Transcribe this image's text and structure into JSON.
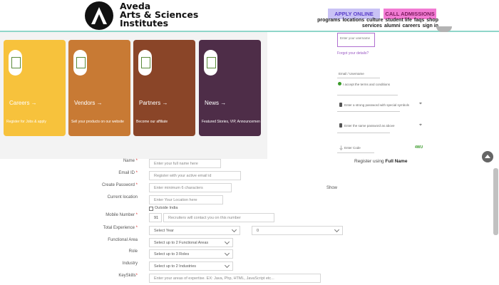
{
  "header": {
    "brand_line1": "Aveda",
    "brand_line2": "Arts & Sciences",
    "brand_line3": "Institutes",
    "apply_label": "APPLY ONLINE",
    "call_label": "CALL ADMISSIONS",
    "nav": [
      "programs",
      "locations",
      "culture",
      "student life",
      "faqs",
      "shop",
      "services",
      "alumni",
      "careers",
      "sign in"
    ]
  },
  "cards": [
    {
      "title": "Careers →",
      "subtitle": "Register for Jobs & apply",
      "color": "#f7c23c"
    },
    {
      "title": "Vendors →",
      "subtitle": "Sell your products on our website",
      "color": "#c87a34"
    },
    {
      "title": "Partners →",
      "subtitle": "Become our affiliate",
      "color": "#8a4528"
    },
    {
      "title": "News →",
      "subtitle": "Featured Stories, VIP, Announcements",
      "color": "#4e2d48"
    }
  ],
  "right_panel": {
    "input_hint": "Enter your username",
    "link": "Forgot your details?",
    "email_label": "Email / Username",
    "email_note": "I accept the terms and conditions",
    "password_label": "Enter a strong password with special symbols",
    "confirm_label": "Enter the same password as above",
    "code_label": "Enter Code",
    "code_value": "4WU",
    "register_prefix": "Register using",
    "register_bold": "Full Name"
  },
  "form": {
    "name_label": "Name",
    "name_placeholder": "Enter your full name here",
    "email_label": "Email ID",
    "email_placeholder": "Register with your active email id",
    "password_label": "Create Password",
    "password_placeholder": "Enter minimum 6 characters",
    "show_label": "Show",
    "location_label": "Current location",
    "location_placeholder": "Enter Your Location here",
    "outside_india_label": "Outside India",
    "mobile_label": "Mobile Number",
    "country_code": "91",
    "mobile_placeholder": "Recruiters will contact you on this number",
    "experience_label": "Total Experience",
    "experience_year": "Select Year",
    "experience_month": "0",
    "functional_label": "Functional Area",
    "functional_value": "Select up to 2 Functional Areas",
    "role_label": "Role",
    "role_value": "Select up to 3 Roles",
    "industry_label": "Industry",
    "industry_value": "Select up to 2 Industries",
    "keyskills_label": "KeySkills",
    "keyskills_placeholder": "Enter your areas of expertise. EX: Java, Php, HTML, JavaScript etc..."
  }
}
